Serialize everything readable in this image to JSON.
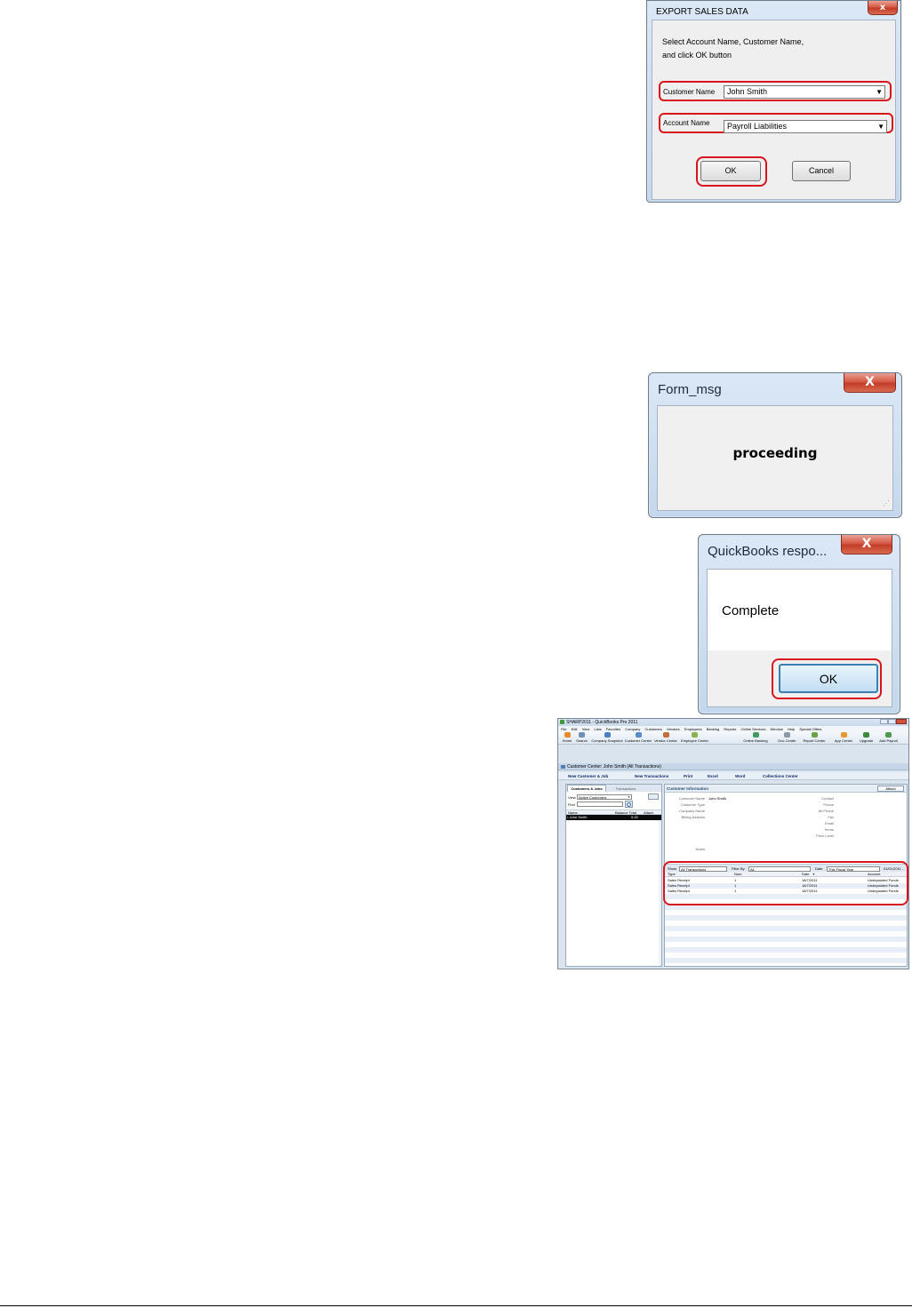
{
  "export_dialog": {
    "title": "EXPORT SALES DATA",
    "close_symbol": "x",
    "instruction_line1": "Select Account Name, Customer Name,",
    "instruction_line2": "and click OK button",
    "customer_label": "Customer Name",
    "customer_value": "John Smith",
    "account_label": "Account Name",
    "account_value": "Payroll Liabilities",
    "ok_label": "OK",
    "cancel_label": "Cancel"
  },
  "form_msg": {
    "title": "Form_msg",
    "close_symbol": "X",
    "message": "proceeding"
  },
  "qb_response": {
    "title": "QuickBooks respo...",
    "close_symbol": "X",
    "message": "Complete",
    "ok_label": "OK"
  },
  "quickbooks": {
    "window_title": "SHARP2011 - QuickBooks Pro 2011",
    "menu": [
      "File",
      "Edit",
      "View",
      "Lists",
      "Favorites",
      "Company",
      "Customers",
      "Vendors",
      "Employees",
      "Banking",
      "Reports",
      "Online Services",
      "Window",
      "Help",
      "Special Offers"
    ],
    "toolbar": [
      "Home",
      "Search",
      "Company Snapshot",
      "Customer Center",
      "Vendor Center",
      "Employee Center",
      "Online Banking",
      "Doc Center",
      "Report Center",
      "App Center",
      "Upgrade",
      "Add Payroll"
    ],
    "center_title": "Customer Center: John Smith (All Transactions)",
    "actions": [
      "New Customer & Job",
      "New Transactions",
      "Print",
      "Excel",
      "Word",
      "Collections Center"
    ],
    "tabs": [
      "Customers & Jobs",
      "Transactions"
    ],
    "view_label": "View",
    "view_value": "Active Customers",
    "find_label": "Find",
    "list_headers": [
      "Name",
      "Balance Total",
      "Attach"
    ],
    "list_rows": [
      {
        "name": "• John Smith",
        "balance": "0.00"
      }
    ],
    "info_header": "Customer Information",
    "attach_label": "Attach",
    "info_left_labels": [
      "Customer Name",
      "Customer Type",
      "Company Name",
      "Billing Address"
    ],
    "customer_name_value": "John Smith",
    "info_right_labels": [
      "Contact",
      "Phone",
      "Alt Phone",
      "Fax",
      "Email",
      "Terms",
      "Price Level"
    ],
    "notes_label": "Notes",
    "filters": {
      "show_label": "Show",
      "show_value": "All Transactions",
      "filter_label": "Filter By",
      "filter_value": "All",
      "date_label": "Date",
      "date_value": "This Fiscal Year",
      "date_range": "01/01/2011 -"
    },
    "columns": [
      "Type",
      "Num",
      "Date",
      "Account"
    ],
    "date_sort_marker": "▼",
    "transactions": [
      {
        "type": "Sales Receipt",
        "num": "1",
        "date": "18/7/2011",
        "account": "Undeposited Funds"
      },
      {
        "type": "Sales Receipt",
        "num": "1",
        "date": "18/7/2011",
        "account": "Undeposited Funds"
      },
      {
        "type": "Sales Receipt",
        "num": "1",
        "date": "18/7/2011",
        "account": "Undeposited Funds"
      }
    ]
  }
}
